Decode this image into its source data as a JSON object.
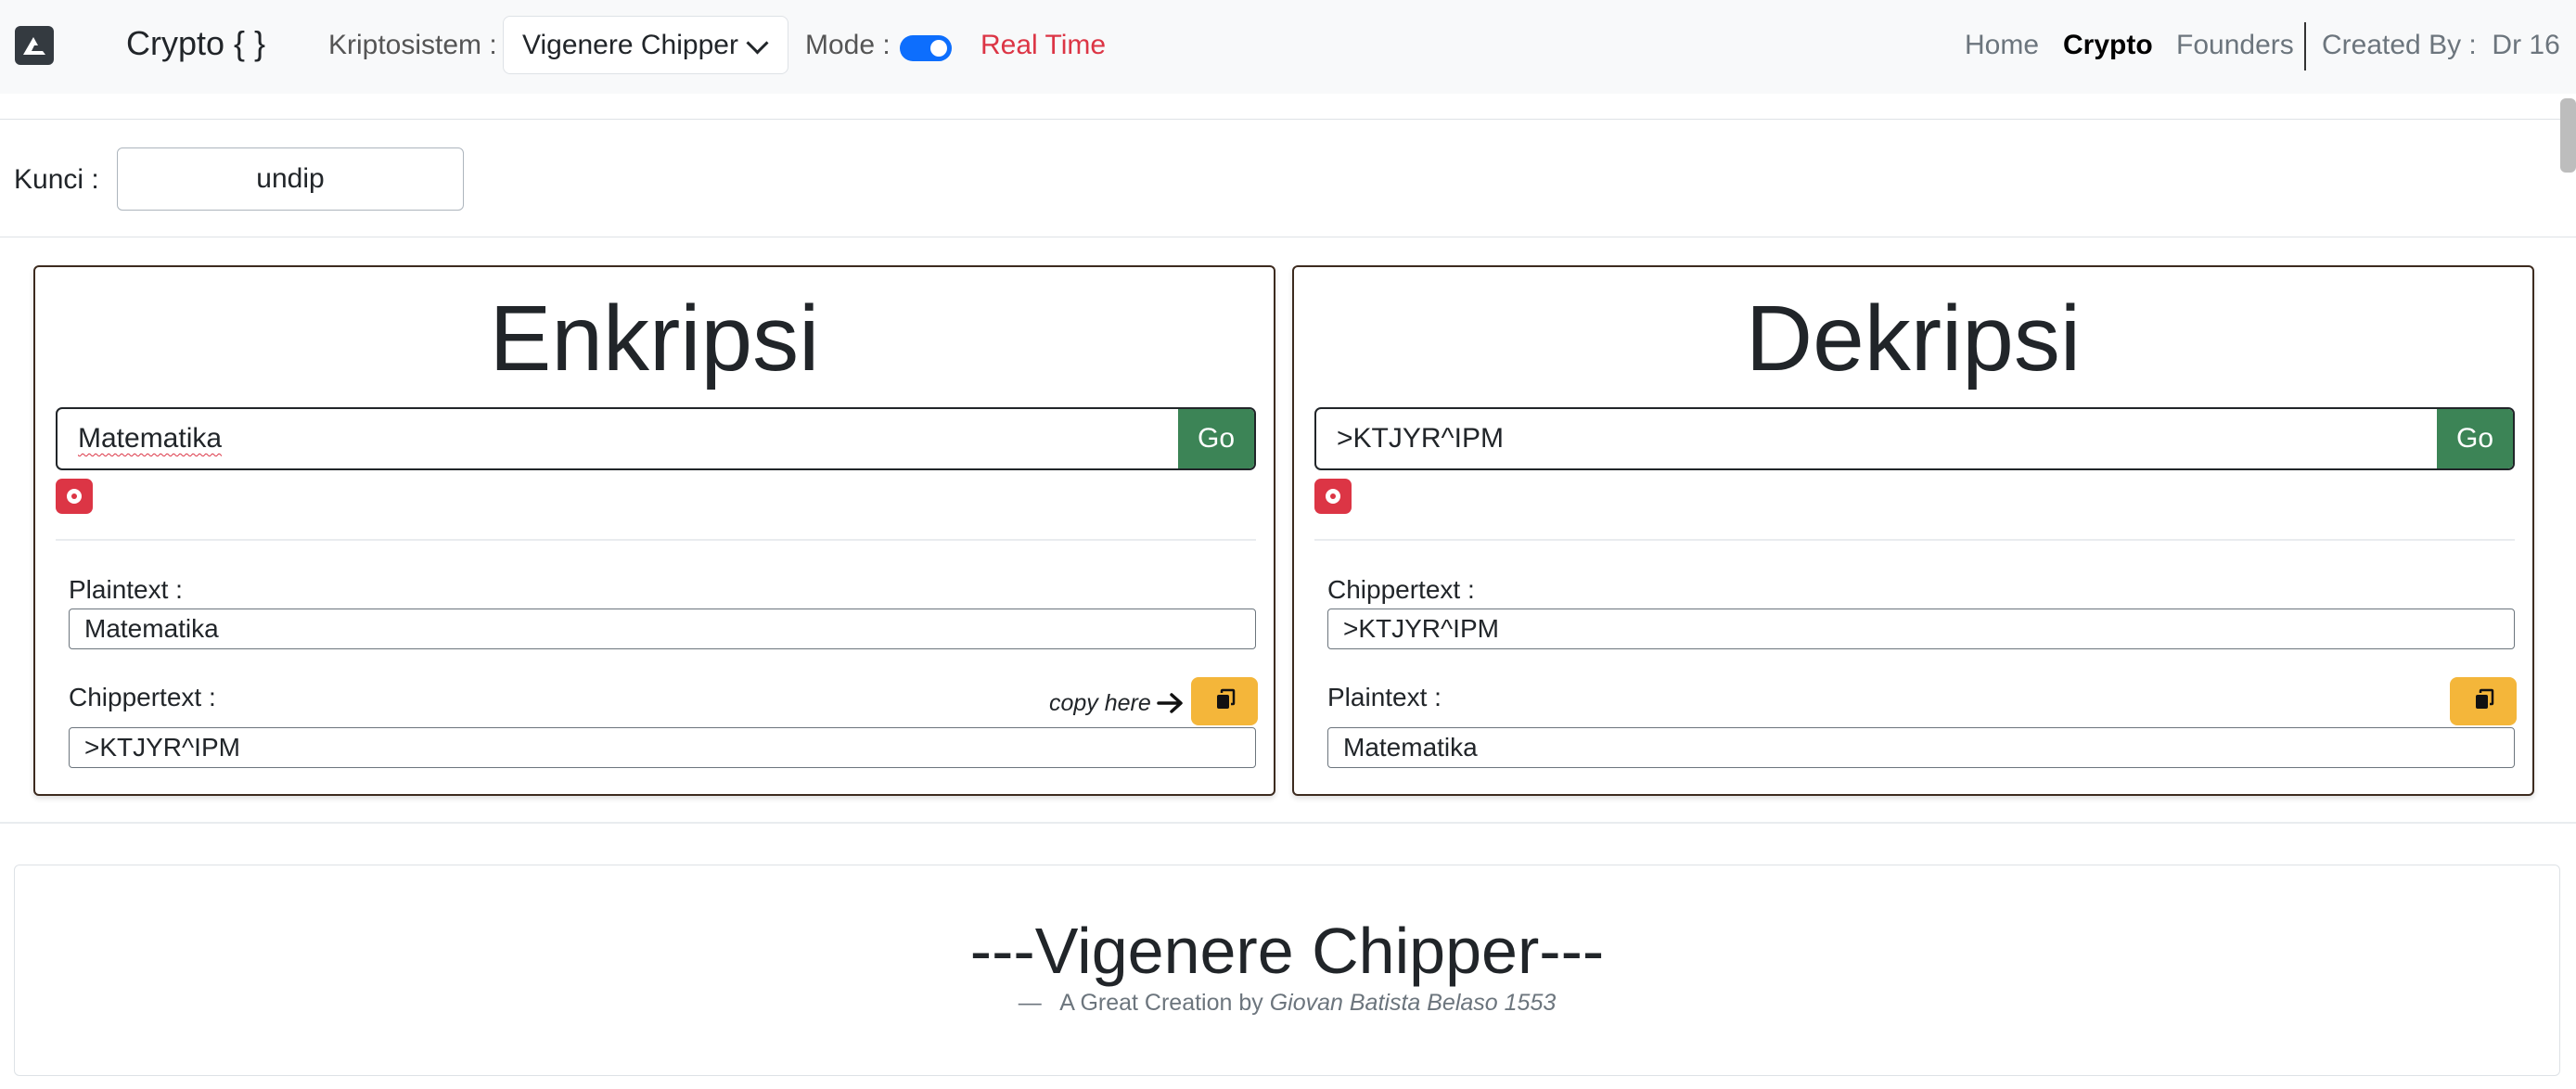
{
  "navbar": {
    "logo_icon": "triangle-logo-icon",
    "brand": "Crypto { }",
    "kriptosistem_label": "Kriptosistem :",
    "cipher_select": "Vigenere Chipper",
    "mode_label": "Mode :",
    "mode_on": true,
    "mode_value": "Real Time",
    "links": [
      "Home",
      "Crypto",
      "Founders"
    ],
    "active_link": "Crypto",
    "created_by": "Created By :  Dr 16"
  },
  "key": {
    "label": "Kunci :",
    "value": "undip"
  },
  "enkripsi": {
    "title": "Enkripsi",
    "input_value": "Matematika",
    "go_label": "Go",
    "plaintext_label": "Plaintext :",
    "plaintext_value": "Matematika",
    "ciphertext_label": "Chippertext :",
    "ciphertext_value": ">KTJYR^IPM",
    "copy_note": "copy here"
  },
  "dekripsi": {
    "title": "Dekripsi",
    "input_value": ">KTJYR^IPM",
    "go_label": "Go",
    "ciphertext_label": "Chippertext :",
    "ciphertext_value": ">KTJYR^IPM",
    "plaintext_label": "Plaintext :",
    "plaintext_value": "Matematika"
  },
  "footer": {
    "title": "---Vigenere Chipper---",
    "dash": "—",
    "subtitle_prefix": "A Great Creation by",
    "author": "Giovan Batista Belaso 1553"
  },
  "colors": {
    "go_button": "#3c8456",
    "clear_button": "#dc3545",
    "copy_button": "#f4b63a",
    "toggle": "#0d6efd",
    "mode_value": "#dc3545"
  }
}
